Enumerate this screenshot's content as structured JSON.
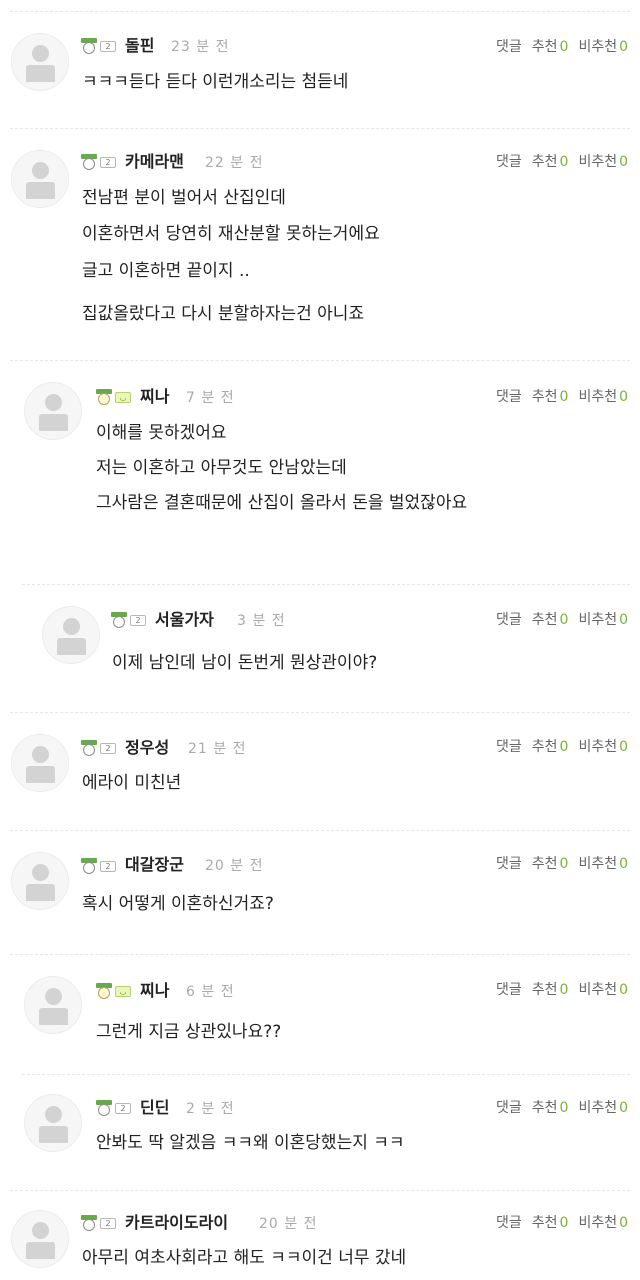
{
  "labels": {
    "reply": "댓글",
    "recommend": "추천",
    "not_recommend": "비추천"
  },
  "comments": [
    {
      "author": "돌핀",
      "level_badge": "2",
      "time": "23 분 전",
      "recommend_count": "0",
      "not_recommend_count": "0",
      "lines": [
        "ㅋㅋㅋ듣다 듣다 이런개소리는 첨듣네"
      ]
    },
    {
      "author": "카메라맨",
      "level_badge": "2",
      "time": "22 분 전",
      "recommend_count": "0",
      "not_recommend_count": "0",
      "lines": [
        "전남편 분이 벌어서 산집인데",
        "이혼하면서 당연히 재산분할 못하는거에요",
        "글고 이혼하면 끝이지 ..",
        "집값올랐다고 다시 분할하자는건 아니죠"
      ]
    },
    {
      "author": "찌나",
      "level_badge": "face",
      "time": "7 분 전",
      "recommend_count": "0",
      "not_recommend_count": "0",
      "lines": [
        "이해를 못하겠어요",
        "저는 이혼하고 아무것도 안남았는데",
        "그사람은 결혼때문에 산집이 올라서 돈을 벌었잖아요"
      ]
    },
    {
      "author": "서울가자",
      "level_badge": "2",
      "time": "3 분 전",
      "recommend_count": "0",
      "not_recommend_count": "0",
      "lines": [
        "이제 남인데 남이 돈번게 뭔상관이야?"
      ]
    },
    {
      "author": "정우성",
      "level_badge": "2",
      "time": "21 분 전",
      "recommend_count": "0",
      "not_recommend_count": "0",
      "lines": [
        "에라이 미친년"
      ]
    },
    {
      "author": "대갈장군",
      "level_badge": "2",
      "time": "20 분 전",
      "recommend_count": "0",
      "not_recommend_count": "0",
      "lines": [
        "혹시 어떻게 이혼하신거죠?"
      ]
    },
    {
      "author": "찌나",
      "level_badge": "face",
      "time": "6 분 전",
      "recommend_count": "0",
      "not_recommend_count": "0",
      "lines": [
        "그런게 지금 상관있나요??"
      ]
    },
    {
      "author": "딘딘",
      "level_badge": "2",
      "time": "2 분 전",
      "recommend_count": "0",
      "not_recommend_count": "0",
      "lines": [
        "안봐도 딱 알겠음 ㅋㅋ왜 이혼당했는지 ㅋㅋ"
      ]
    },
    {
      "author": "카트라이도라이",
      "level_badge": "2",
      "time": "20 분 전",
      "recommend_count": "0",
      "not_recommend_count": "0",
      "lines": [
        "아무리 여초사회라고 해도  ㅋㅋ이건 너무 갔네"
      ]
    }
  ]
}
